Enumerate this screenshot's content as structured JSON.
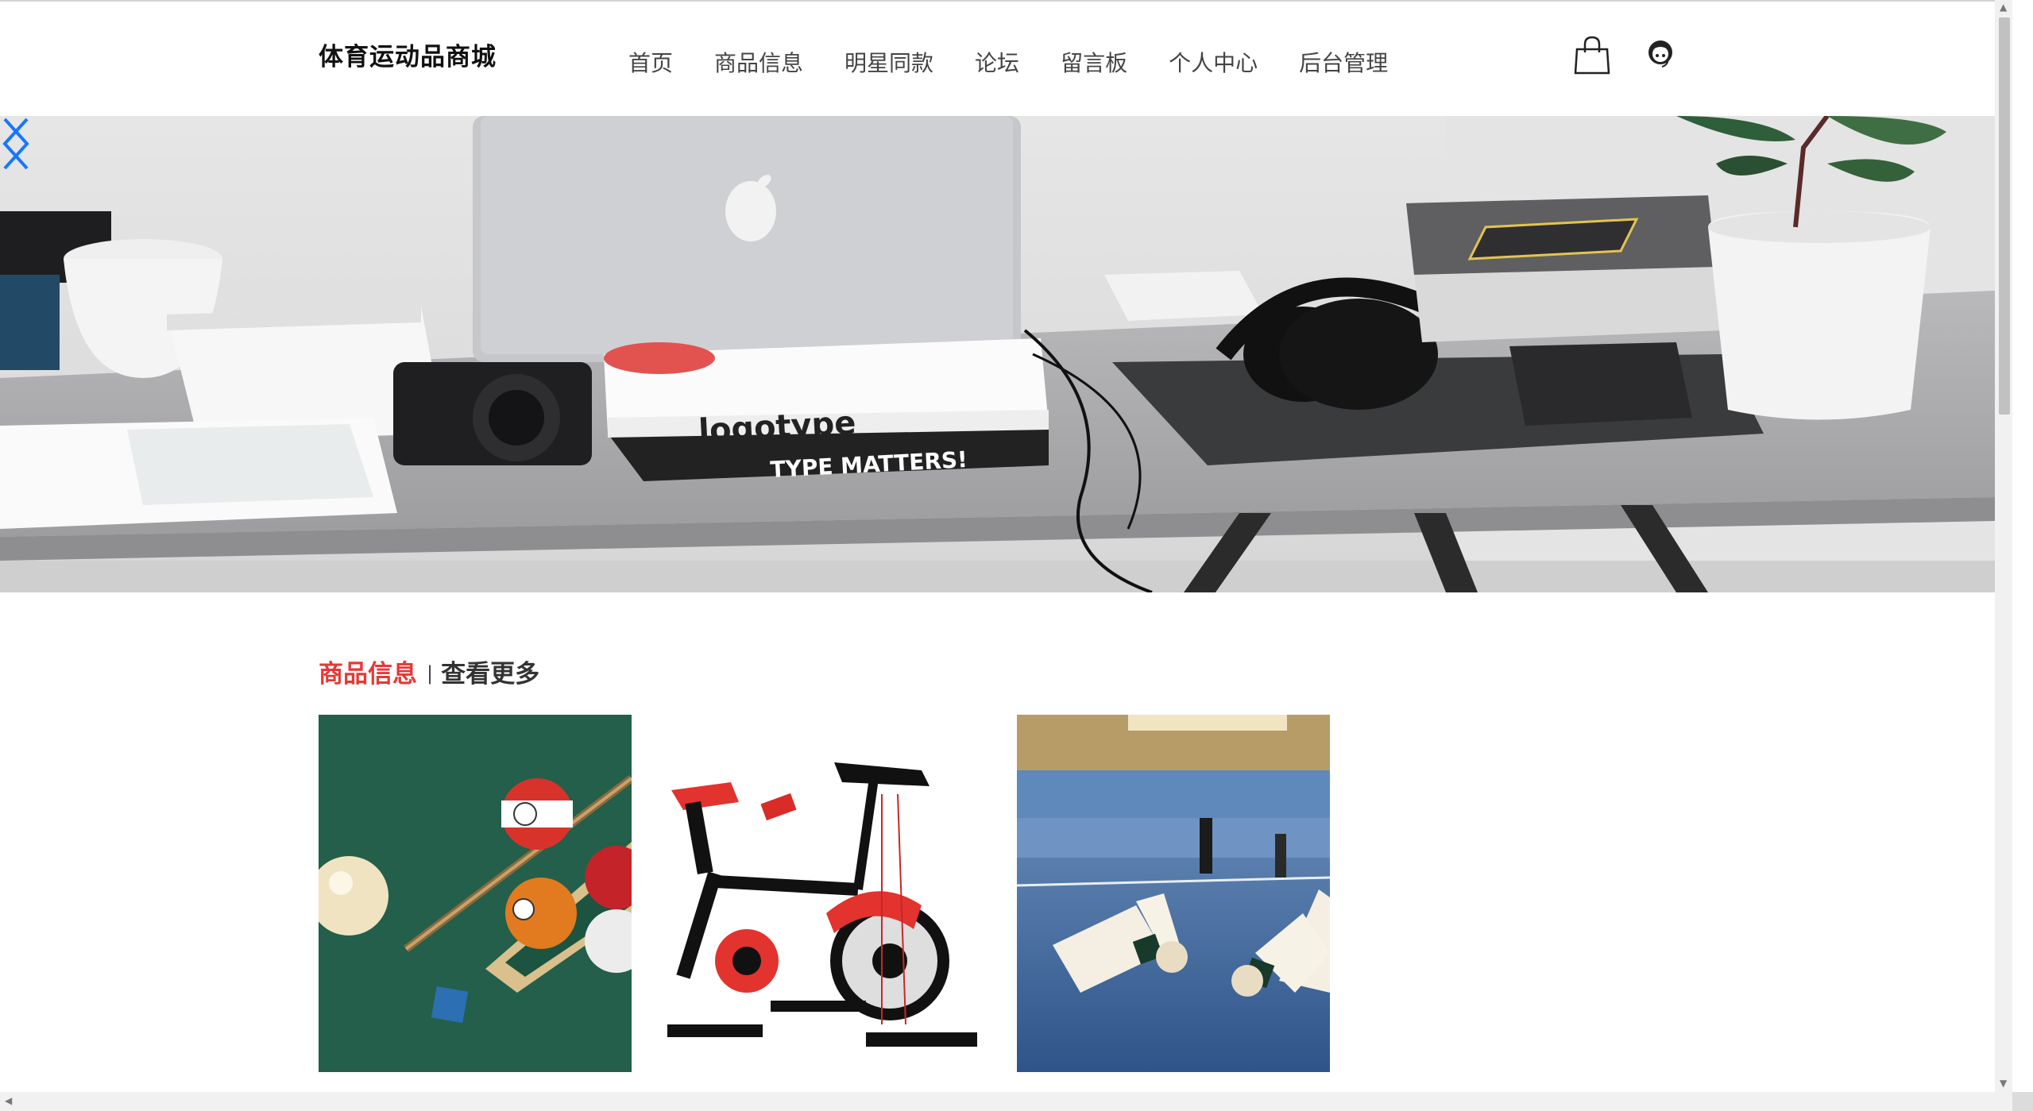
{
  "header": {
    "logo": "体育运动品商城",
    "nav": [
      "首页",
      "商品信息",
      "明星同款",
      "论坛",
      "留言板",
      "个人中心",
      "后台管理"
    ]
  },
  "banner": {
    "slide_count": 5,
    "active_index": 0,
    "book_title": "logotype",
    "book_subtitle": "TYPE MATTERS!"
  },
  "section": {
    "title": "商品信息",
    "separator": "|",
    "more_label": "查看更多"
  },
  "products": [
    "billiards",
    "exercise-bike",
    "badminton"
  ],
  "colors": {
    "accent": "#e53935",
    "carousel_active": "#1677ff"
  }
}
